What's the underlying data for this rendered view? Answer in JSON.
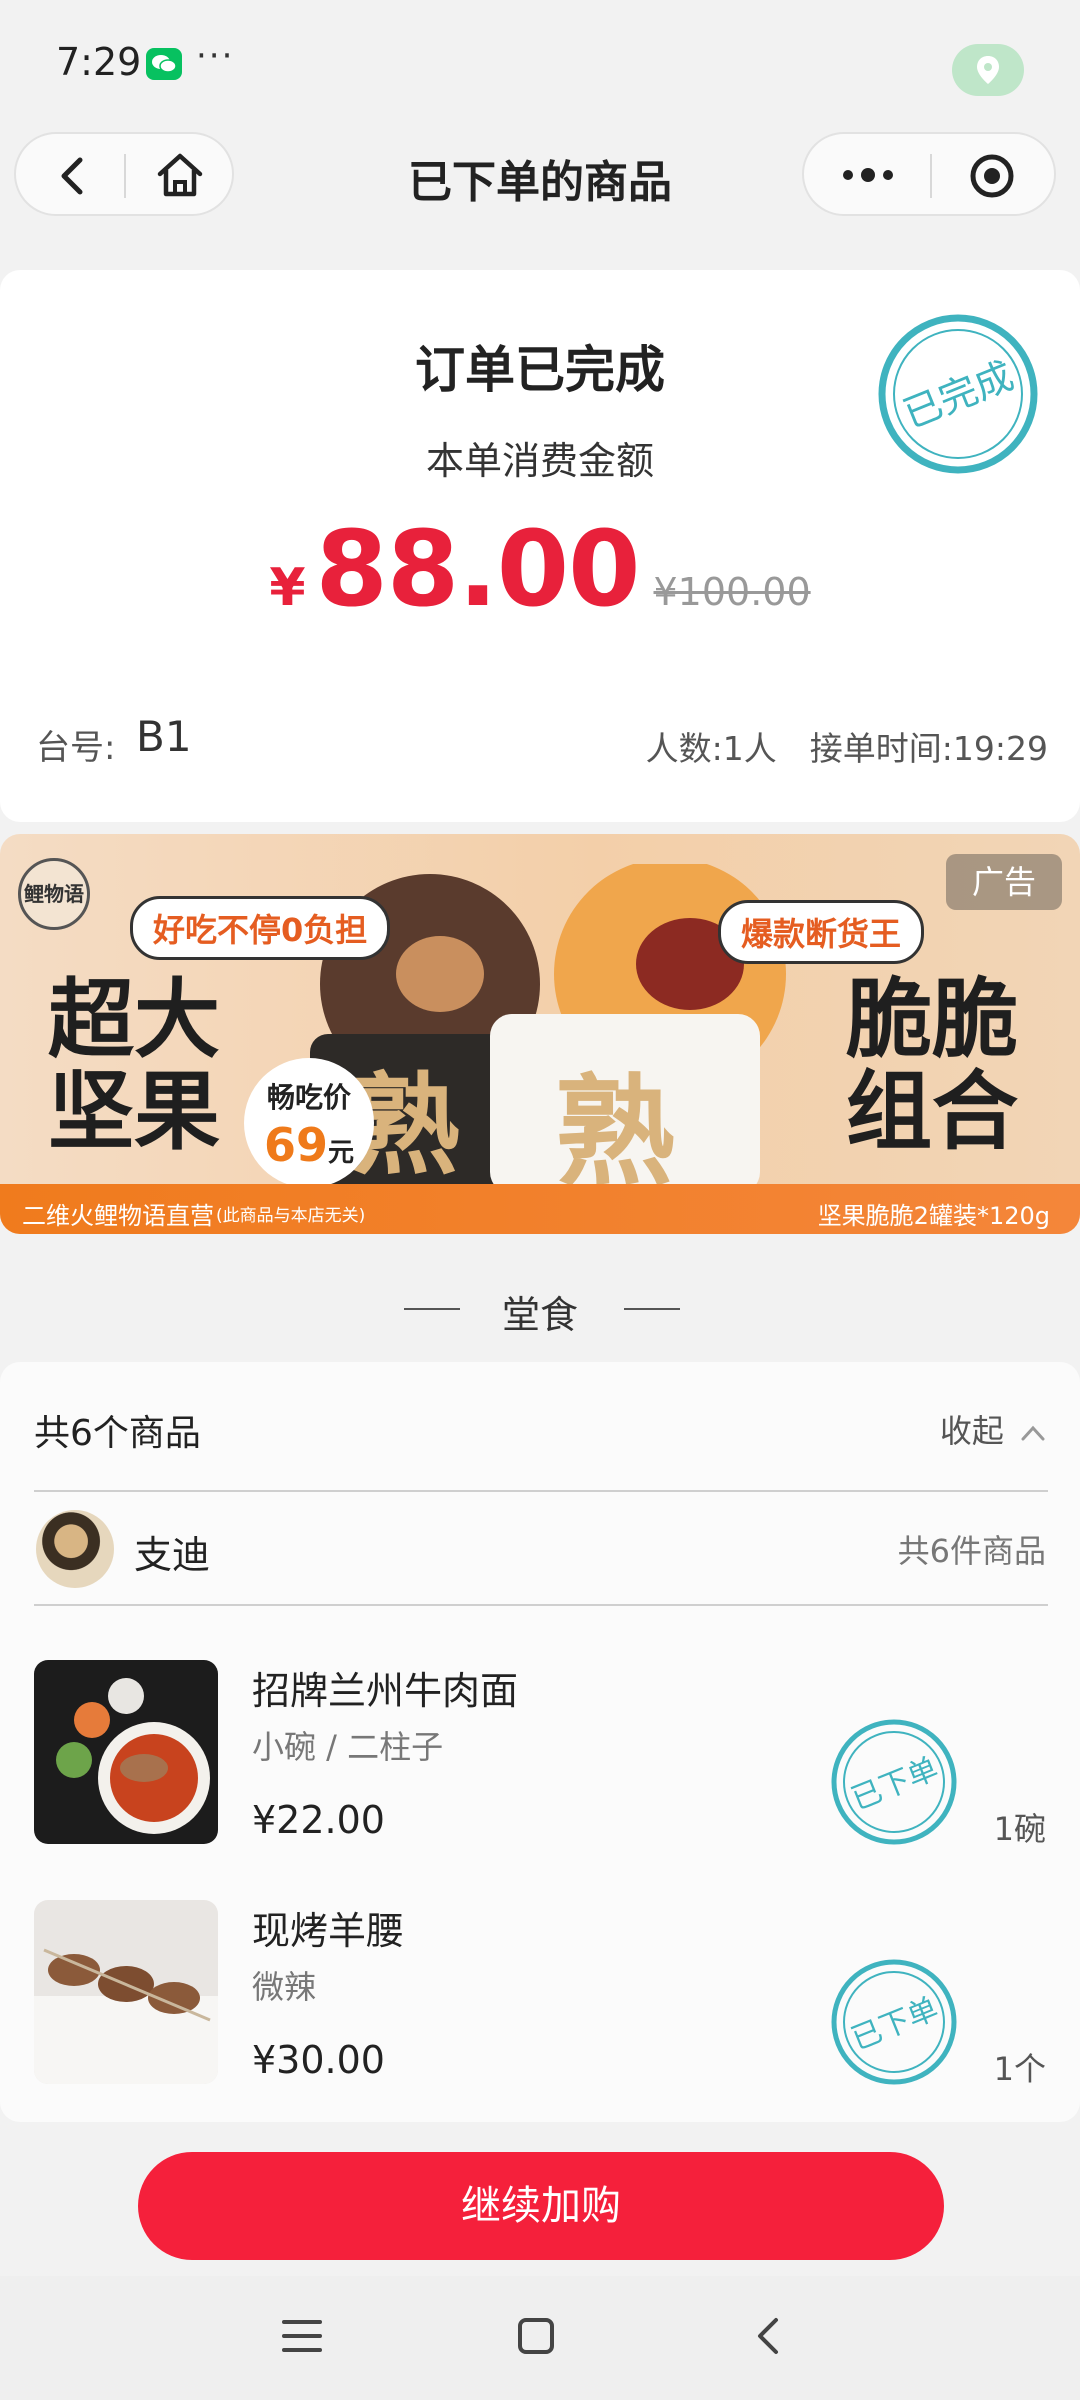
{
  "status_bar": {
    "time": "7:29",
    "more": "···"
  },
  "nav": {
    "title": "已下单的商品"
  },
  "order": {
    "title": "订单已完成",
    "amount_label": "本单消费金额",
    "currency": "¥",
    "amount": "88.00",
    "original_price": "¥100.00",
    "stamp_text": "已完成",
    "table_label": "台号:",
    "table_value": "B1",
    "meta": "人数:1人　接单时间:19:29"
  },
  "ad": {
    "logo_text": "鲤物语",
    "tag": "广告",
    "bubble_left": "好吃不停0负担",
    "bubble_right": "爆款断货王",
    "left_big": "超大\n坚果",
    "right_big": "脆脆\n组合",
    "price_label": "畅吃价",
    "price_value": "69",
    "price_unit": "元",
    "strip_left": "二维火鲤物语直营",
    "strip_left_note": "(此商品与本店无关)",
    "strip_right": "坚果脆脆2罐装*120g"
  },
  "section": {
    "dine_title": "堂食"
  },
  "items_card": {
    "count_label": "共6个商品",
    "collapse_label": "收起",
    "user_name": "支迪",
    "user_count": "共6件商品",
    "stamp_text": "已下单",
    "items": [
      {
        "name": "招牌兰州牛肉面",
        "spec": "小碗 / 二柱子",
        "price": "¥22.00",
        "qty": "1碗"
      },
      {
        "name": "现烤羊腰",
        "spec": "微辣",
        "price": "¥30.00",
        "qty": "1个"
      }
    ]
  },
  "bottom": {
    "continue_label": "继续加购"
  },
  "colors": {
    "accent_red": "#f5203b",
    "price_red": "#e8213b",
    "stamp_teal": "#3fb3bf"
  }
}
